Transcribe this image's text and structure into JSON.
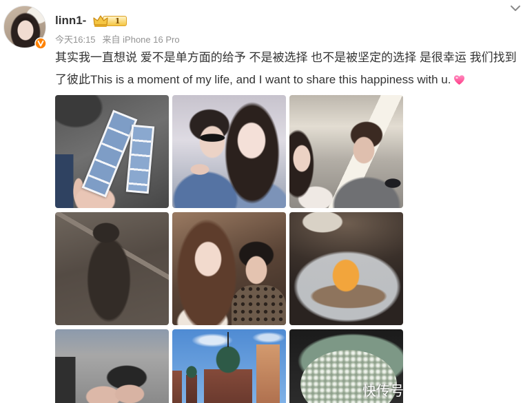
{
  "post": {
    "author": {
      "name": "linn1-",
      "vip_level": "1"
    },
    "meta": {
      "time": "今天16:15",
      "source": "来自 iPhone 16 Pro"
    },
    "text": "其实我一直想说 爱不是单方面的给予 不是被选择 也不是被坚定的选择 是很幸运 我们找到了彼此This is a moment of my life, and I want to share this happiness with u."
  },
  "watermark": "快传号",
  "icons": {
    "more": "chevron-down-icon",
    "verified": "verified-v-icon",
    "vip": "crown-icon",
    "emoji": "pink-heart-icon"
  },
  "colors": {
    "text": "#333333",
    "meta": "#939393",
    "accent_orange": "#ff8200",
    "vip_gold": "#f5c643",
    "heart_pink": "#ff4f93"
  }
}
